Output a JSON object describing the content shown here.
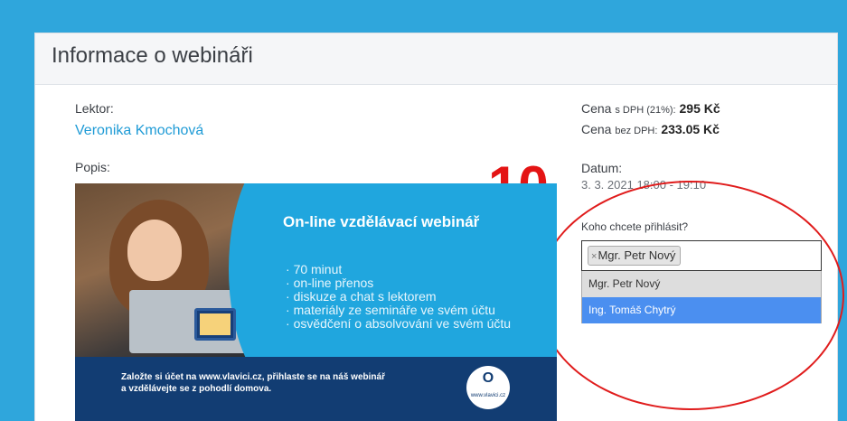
{
  "card": {
    "title": "Informace o webináři"
  },
  "lector": {
    "label": "Lektor:",
    "name": "Veronika Kmochová"
  },
  "description": {
    "label": "Popis:"
  },
  "price": {
    "with_vat_prefix": "Cena",
    "with_vat_small": "s DPH (21%):",
    "with_vat_value": "295 Kč",
    "without_vat_prefix": "Cena",
    "without_vat_small": "bez DPH:",
    "without_vat_value": "233.05 Kč"
  },
  "date": {
    "label": "Datum:",
    "value": "3. 3. 2021 18:00 - 19:10"
  },
  "annotation": {
    "number": "10",
    "color": "#e41414"
  },
  "registration": {
    "label": "Koho chcete přihlásit?",
    "selected_chip": "Mgr. Petr Nový",
    "chip_remove": "×",
    "options": [
      {
        "label": "Mgr. Petr Nový",
        "state": "selected"
      },
      {
        "label": "Ing. Tomáš Chytrý",
        "state": "highlighted"
      }
    ]
  },
  "banner": {
    "title": "On-line vzdělávací webinář",
    "bullets": [
      "70 minut",
      "on-line přenos",
      "diskuze a chat s lektorem",
      "materiály ze semináře ve svém účtu",
      "osvědčení o absolvování ve svém účtu"
    ],
    "footer_line1": "Založte si účet na www.vlavici.cz, přihlaste se na náš webinář",
    "footer_line2": "a vzdělávejte se z pohodlí domova.",
    "logo_letter": "O",
    "logo_text": "www.vlavici.cz"
  },
  "colors": {
    "background": "#2fa6dc",
    "link": "#1f9bd6",
    "highlight": "#4b8ff0",
    "banner_footer": "#123d73"
  }
}
